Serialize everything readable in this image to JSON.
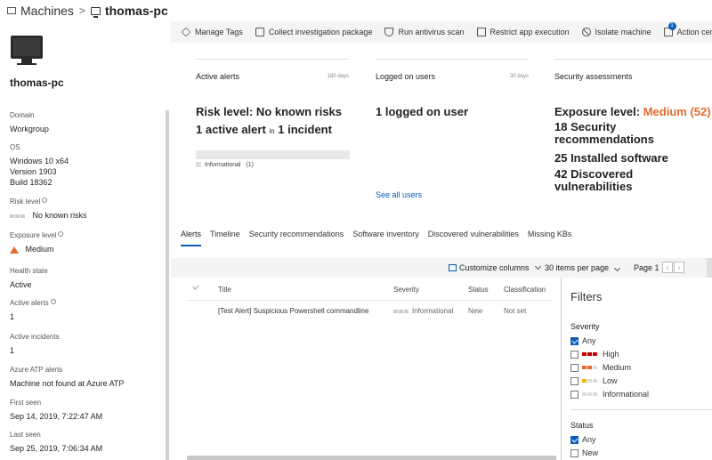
{
  "breadcrumb": {
    "root": "Machines",
    "current": "thomas-pc"
  },
  "toolbar": {
    "items": [
      {
        "label": "Manage Tags",
        "icon": "tag-icon"
      },
      {
        "label": "Collect investigation package",
        "icon": "package-icon"
      },
      {
        "label": "Run antivirus scan",
        "icon": "shield-icon"
      },
      {
        "label": "Restrict app execution",
        "icon": "restrict-icon"
      },
      {
        "label": "Isolate machine",
        "icon": "ban-icon"
      },
      {
        "label": "Action center",
        "icon": "action-center-icon"
      }
    ],
    "action_center_badge": "1"
  },
  "machine": {
    "name": "thomas-pc",
    "domain_label": "Domain",
    "domain": "Workgroup",
    "os_label": "OS",
    "os_name": "Windows 10 x64",
    "os_version": "Version 1903",
    "os_build": "Build 18362",
    "risk_label": "Risk level",
    "risk": "No known risks",
    "exposure_label": "Exposure level",
    "exposure": "Medium",
    "health_label": "Health state",
    "health": "Active",
    "active_alerts_label": "Active alerts",
    "active_alerts": "1",
    "active_incidents_label": "Active incidents",
    "active_incidents": "1",
    "atp_label": "Azure ATP alerts",
    "atp": "Machine not found at Azure ATP",
    "first_seen_label": "First seen",
    "first_seen": "Sep 14, 2019, 7:22:47 AM",
    "last_seen_label": "Last seen",
    "last_seen": "Sep 25, 2019, 7:06:34 AM"
  },
  "cards": {
    "alerts": {
      "title": "Active alerts",
      "days": "180 days",
      "line1": "Risk level: No known risks",
      "line2a": "1 active alert",
      "line2b": "in",
      "line2c": "1 incident",
      "legend": "Informational",
      "legend_count": "(1)"
    },
    "users": {
      "title": "Logged on users",
      "days": "30 days",
      "line1": "1 logged on user",
      "link": "See all users"
    },
    "security": {
      "title": "Security assessments",
      "exposure_prefix": "Exposure level: ",
      "exposure_value": "Medium (52)",
      "line2": "18 Security recommendations",
      "line3": "25 Installed software",
      "line4": "42 Discovered vulnerabilities"
    }
  },
  "tabs": [
    "Alerts",
    "Timeline",
    "Security recommendations",
    "Software inventory",
    "Discovered vulnerabilities",
    "Missing KBs"
  ],
  "table_bar": {
    "customize": "Customize columns",
    "per_page": "30 items per page",
    "page": "Page 1"
  },
  "table": {
    "headers": [
      "Title",
      "Severity",
      "Status",
      "Classification"
    ],
    "rows": [
      {
        "title": "[Test Alert] Suspicious Powershell commandline",
        "severity": "Informational",
        "status": "New",
        "classification": "Not set"
      }
    ]
  },
  "filters": {
    "title": "Filters",
    "severity_label": "Severity",
    "severity_options": [
      {
        "label": "Any",
        "checked": true
      },
      {
        "label": "High",
        "checked": false,
        "color": "#c00000"
      },
      {
        "label": "Medium",
        "checked": false,
        "color": "#e36a2c"
      },
      {
        "label": "Low",
        "checked": false,
        "color": "#f2b600"
      },
      {
        "label": "Informational",
        "checked": false,
        "color": "#cccccc"
      }
    ],
    "status_label": "Status",
    "status_options": [
      {
        "label": "Any",
        "checked": true
      },
      {
        "label": "New",
        "checked": false
      }
    ]
  },
  "colors": {
    "accent": "#0b5fb8",
    "orange": "#e36a2c"
  }
}
